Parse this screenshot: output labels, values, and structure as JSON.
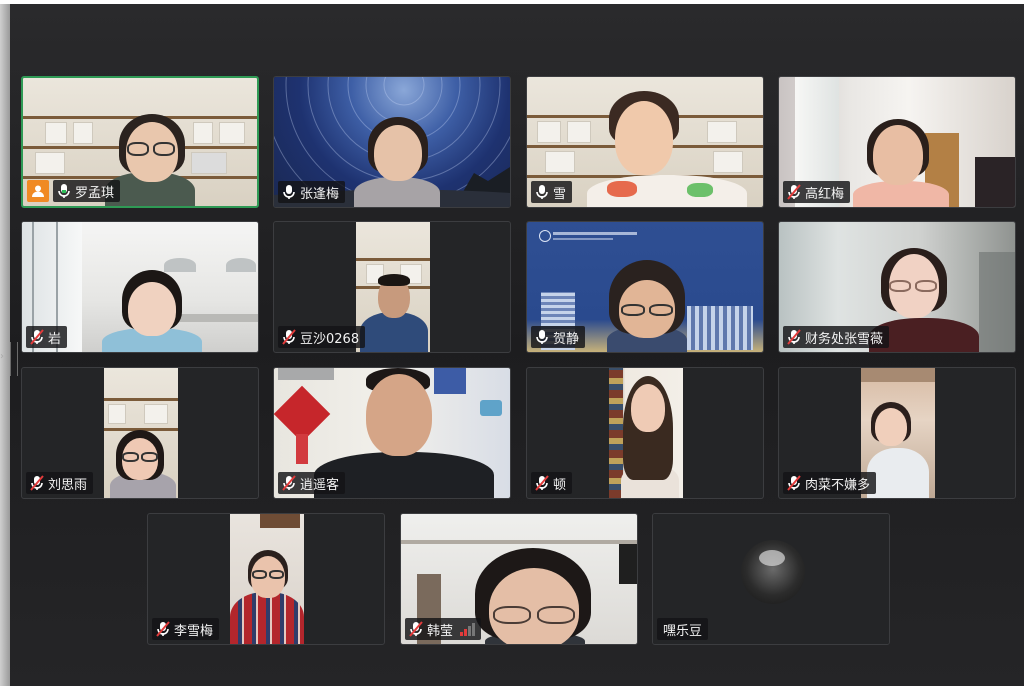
{
  "participants": [
    {
      "name": "罗孟琪",
      "mic": "on",
      "host": true
    },
    {
      "name": "张逢梅",
      "mic": "on"
    },
    {
      "name": "雪",
      "mic": "on"
    },
    {
      "name": "高红梅",
      "mic": "muted"
    },
    {
      "name": "岩",
      "mic": "muted"
    },
    {
      "name": "豆沙0268",
      "mic": "muted"
    },
    {
      "name": "贺静",
      "mic": "on"
    },
    {
      "name": "财务处张雪薇",
      "mic": "muted"
    },
    {
      "name": "刘思雨",
      "mic": "muted"
    },
    {
      "name": "逍遥客",
      "mic": "muted"
    },
    {
      "name": "顿",
      "mic": "muted"
    },
    {
      "name": "肉菜不嫌多",
      "mic": "muted"
    },
    {
      "name": "李雪梅",
      "mic": "muted"
    },
    {
      "name": "韩莹",
      "mic": "muted",
      "signal": "weak"
    },
    {
      "name": "嘿乐豆",
      "mic": "none",
      "video": "off"
    }
  ],
  "colors": {
    "active_speaker_border": "#2f9a55",
    "host_badge": "#f08a24",
    "muted_mic": "#e23b3b",
    "stage_bg": "#252527"
  }
}
